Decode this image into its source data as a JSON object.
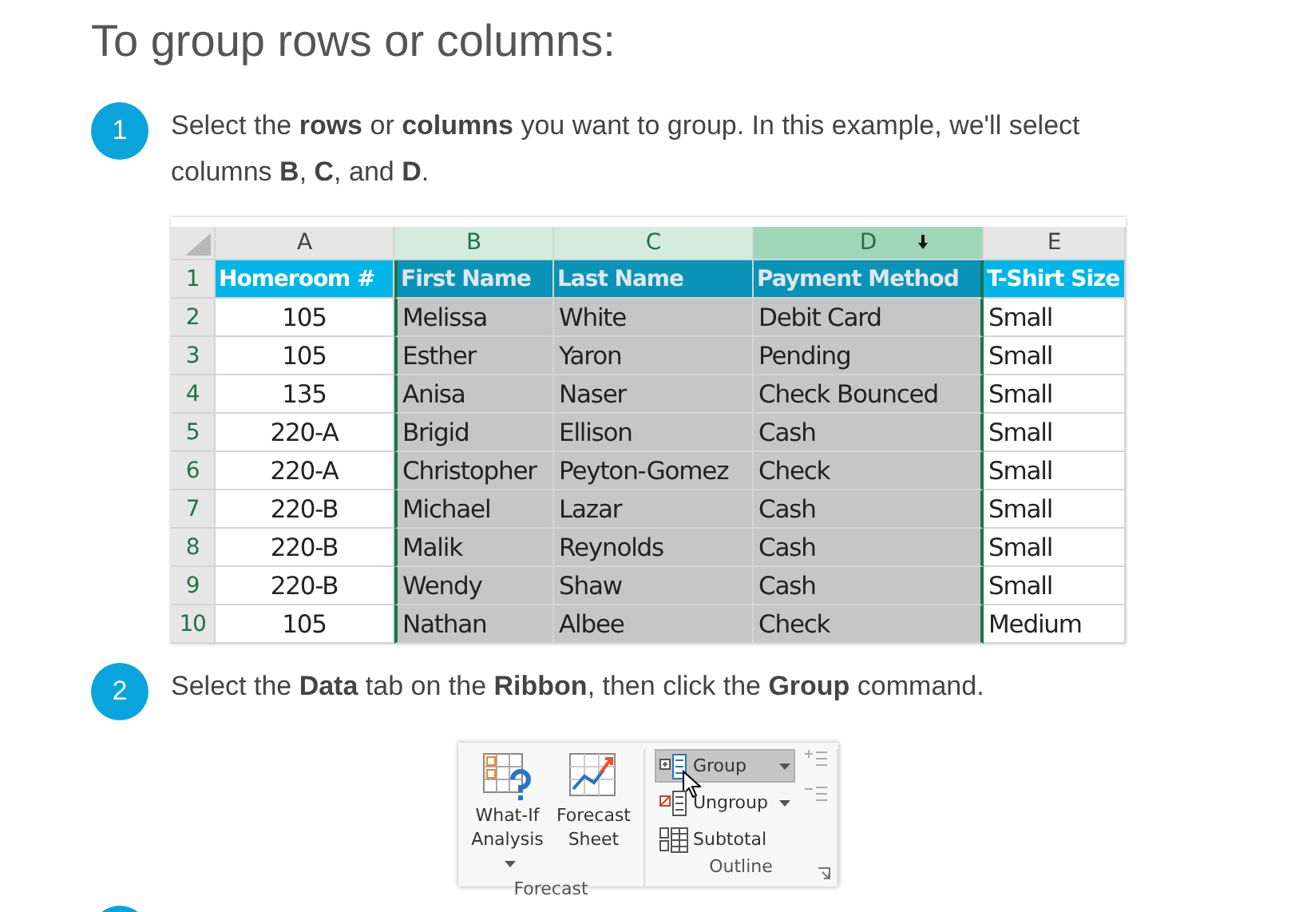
{
  "heading": "To group rows or columns:",
  "steps": [
    {
      "kind": "text",
      "number": "1",
      "text": "Select the **rows** or **columns** you want to group. In this example, we'll select columns **B**, **C**, and **D**."
    },
    {
      "kind": "sheet"
    },
    {
      "kind": "text",
      "number": "2",
      "text": "Select the **Data** tab on the **Ribbon**, then click the **Group** command."
    },
    {
      "kind": "ribbon"
    },
    {
      "kind": "partial"
    }
  ],
  "sheet": {
    "columns": [
      {
        "letter": "A",
        "selected": false
      },
      {
        "letter": "B",
        "selected": true
      },
      {
        "letter": "C",
        "selected": true
      },
      {
        "letter": "D",
        "selected": true
      },
      {
        "letter": "E",
        "selected": false
      }
    ],
    "rows": [
      {
        "number": "1",
        "kind": "header",
        "cells": [
          "Homeroom #",
          "First Name",
          "Last Name",
          "Payment Method",
          "T-Shirt Size"
        ]
      },
      {
        "number": "2",
        "kind": "data",
        "cells": [
          "105",
          "Melissa",
          "White",
          "Debit Card",
          "Small"
        ]
      },
      {
        "number": "3",
        "kind": "data",
        "cells": [
          "105",
          "Esther",
          "Yaron",
          "Pending",
          "Small"
        ]
      },
      {
        "number": "4",
        "kind": "data",
        "cells": [
          "135",
          "Anisa",
          "Naser",
          "Check Bounced",
          "Small"
        ]
      },
      {
        "number": "5",
        "kind": "data",
        "cells": [
          "220-A",
          "Brigid",
          "Ellison",
          "Cash",
          "Small"
        ]
      },
      {
        "number": "6",
        "kind": "data",
        "cells": [
          "220-A",
          "Christopher",
          "Peyton-Gomez",
          "Check",
          "Small"
        ]
      },
      {
        "number": "7",
        "kind": "data",
        "cells": [
          "220-B",
          "Michael",
          "Lazar",
          "Cash",
          "Small"
        ]
      },
      {
        "number": "8",
        "kind": "data",
        "cells": [
          "220-B",
          "Malik",
          "Reynolds",
          "Cash",
          "Small"
        ]
      },
      {
        "number": "9",
        "kind": "data",
        "cells": [
          "220-B",
          "Wendy",
          "Shaw",
          "Cash",
          "Small"
        ]
      },
      {
        "number": "10",
        "kind": "data",
        "cells": [
          "105",
          "Nathan",
          "Albee",
          "Check",
          "Medium"
        ]
      }
    ]
  },
  "ribbon": {
    "groups": [
      {
        "label": "Forecast",
        "kind": "large",
        "buttons": [
          {
            "lines": [
              "What-If",
              "Analysis"
            ],
            "dropdown": true
          },
          {
            "lines": [
              "Forecast",
              "Sheet"
            ],
            "dropdown": false
          }
        ]
      },
      {
        "label": "Outline",
        "kind": "small",
        "buttons": [
          {
            "label": "Group",
            "dropdown": true,
            "selected": true
          },
          {
            "label": "Ungroup",
            "dropdown": true,
            "selected": false
          },
          {
            "label": "Subtotal",
            "dropdown": false,
            "selected": false
          }
        ]
      }
    ]
  }
}
